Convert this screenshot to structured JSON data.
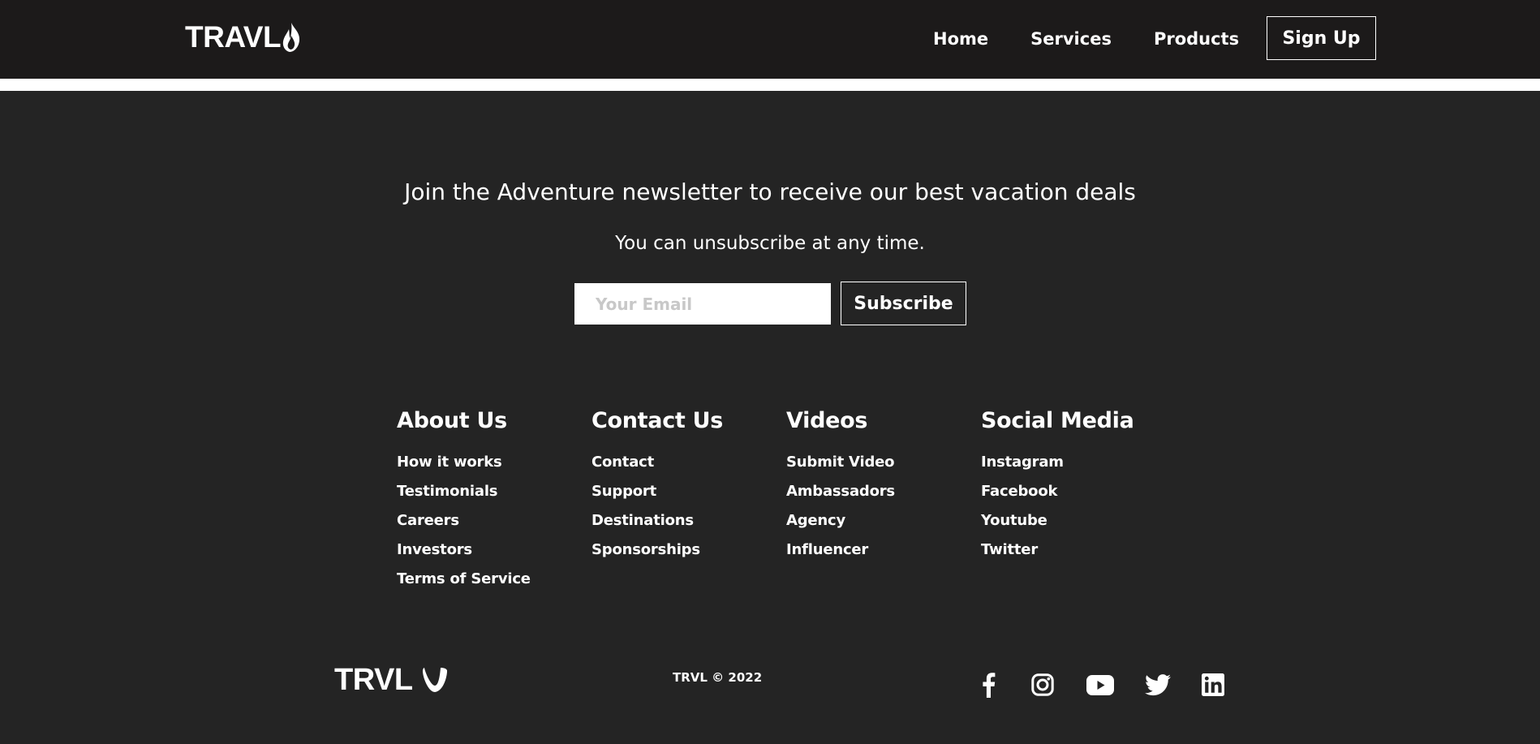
{
  "header": {
    "logo_text": "TRAVL",
    "nav": [
      {
        "label": "Home"
      },
      {
        "label": "Services"
      },
      {
        "label": "Products"
      }
    ],
    "signup_label": "Sign Up"
  },
  "newsletter": {
    "title": "Join the Adventure newsletter to receive our best vacation deals",
    "subtitle": "You can unsubscribe at any time.",
    "email_placeholder": "Your Email",
    "subscribe_label": "Subscribe"
  },
  "footer": {
    "columns": [
      {
        "heading": "About Us",
        "links": [
          "How it works",
          "Testimonials",
          "Careers",
          "Investors",
          "Terms of Service"
        ]
      },
      {
        "heading": "Contact Us",
        "links": [
          "Contact",
          "Support",
          "Destinations",
          "Sponsorships"
        ]
      },
      {
        "heading": "Videos",
        "links": [
          "Submit Video",
          "Ambassadors",
          "Agency",
          "Influencer"
        ]
      },
      {
        "heading": "Social Media",
        "links": [
          "Instagram",
          "Facebook",
          "Youtube",
          "Twitter"
        ]
      }
    ],
    "logo_text": "TRVL",
    "copyright": "TRVL © 2022",
    "social_icons": [
      "facebook-icon",
      "instagram-icon",
      "youtube-icon",
      "twitter-icon",
      "linkedin-icon"
    ]
  },
  "colors": {
    "nav_background": "#1c1a1a",
    "page_background": "#242424",
    "text": "#ffffff"
  }
}
